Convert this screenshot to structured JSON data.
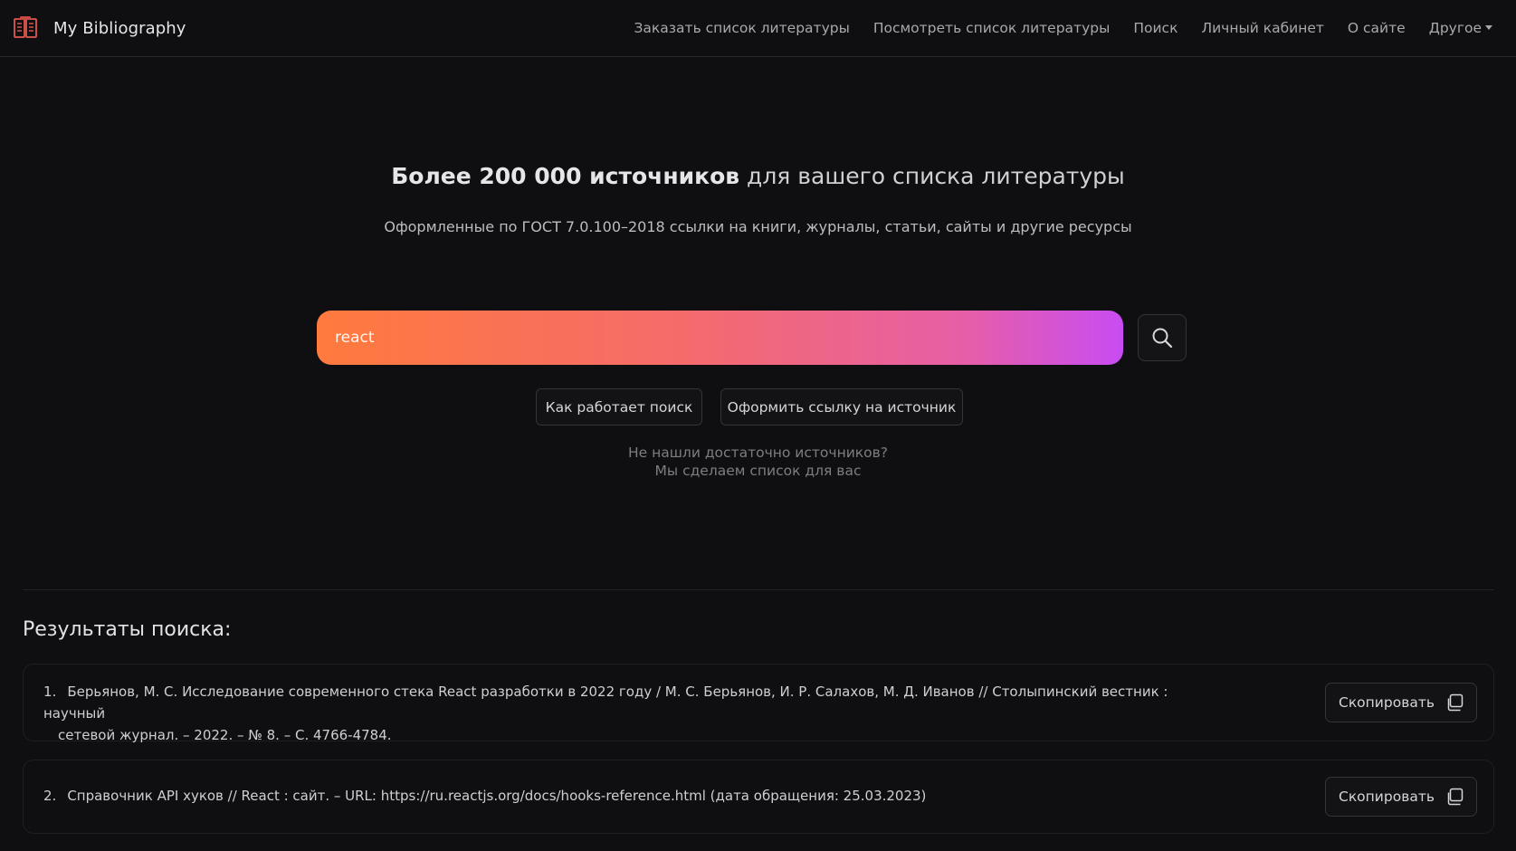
{
  "navbar": {
    "brand": "My Bibliography",
    "links": [
      "Заказать список литературы",
      "Посмотреть список литературы",
      "Поиск",
      "Личный кабинет",
      "О сайте",
      "Другое"
    ]
  },
  "hero": {
    "title_bold": "Более 200 000 источников",
    "title_rest": " для вашего списка литературы",
    "subtitle": "Оформленные по ГОСТ 7.0.100–2018 ссылки на книги, журналы, статьи, сайты и другие ресурсы"
  },
  "search": {
    "value": "react",
    "icon": "search-icon",
    "how_label": "Как работает поиск",
    "format_label": "Оформить ссылку на источник",
    "hint_line1": "Не нашли достаточно источников?",
    "hint_line2": "Мы сделаем список для вас"
  },
  "results": {
    "title": "Результаты поиска:",
    "items": [
      {
        "num": "1.",
        "line1": "Берьянов, М. С. Исследование современного стека React разработки в 2022 году / М. С. Берьянов, И. Р. Салахов, М. Д. Иванов // Столыпинский вестник : научный",
        "line2": "сетевой журнал. – 2022. – № 8. – С. 4766-4784.",
        "copy_label": "Скопировать"
      },
      {
        "num": "2.",
        "line1": "Справочник API хуков // React : сайт. – URL: https://ru.reactjs.org/docs/hooks-reference.html (дата обращения: 25.03.2023)",
        "copy_label": "Скопировать"
      }
    ]
  },
  "colors": {
    "background": "#0f0f11",
    "search_gradient_start": "#ff7a3d",
    "search_gradient_end": "#c84cf3"
  }
}
